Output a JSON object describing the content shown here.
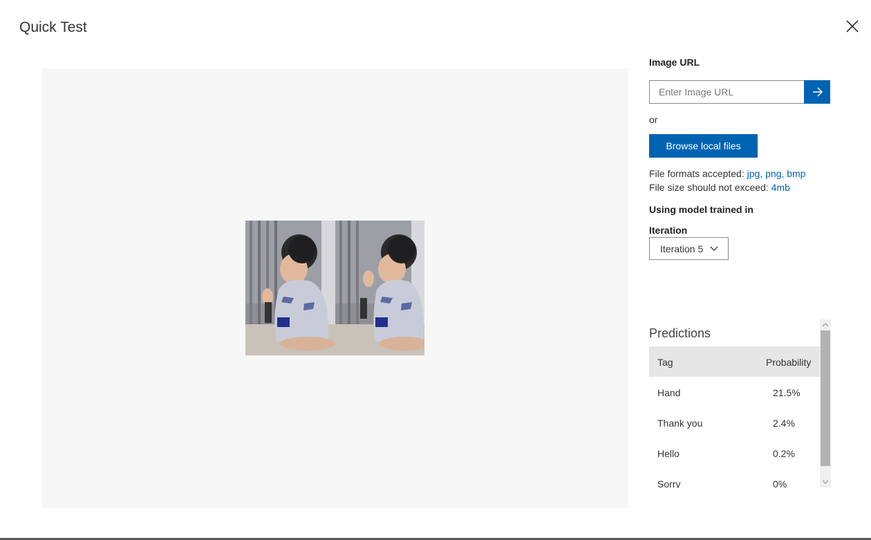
{
  "dialog": {
    "title": "Quick Test",
    "close_icon": "close-icon"
  },
  "image_url": {
    "label": "Image URL",
    "placeholder": "Enter Image URL",
    "value": "",
    "submit_icon": "arrow-right-icon",
    "accent": "#0063b1"
  },
  "or_text": "or",
  "browse_button": "Browse local files",
  "file_formats": {
    "label": "File formats accepted:",
    "value": "jpg, png, bmp"
  },
  "file_size": {
    "label": "File size should not exceed:",
    "value": "4mb"
  },
  "model": {
    "heading": "Using model trained in",
    "iteration_label": "Iteration",
    "selected_iteration": "Iteration 5"
  },
  "predictions": {
    "title": "Predictions",
    "columns": {
      "tag": "Tag",
      "probability": "Probability"
    },
    "rows": [
      {
        "tag": "Hand",
        "probability": "21.5%"
      },
      {
        "tag": "Thank you",
        "probability": "2.4%"
      },
      {
        "tag": "Hello",
        "probability": "0.2%"
      },
      {
        "tag": "Sorry",
        "probability": "0%"
      }
    ]
  }
}
